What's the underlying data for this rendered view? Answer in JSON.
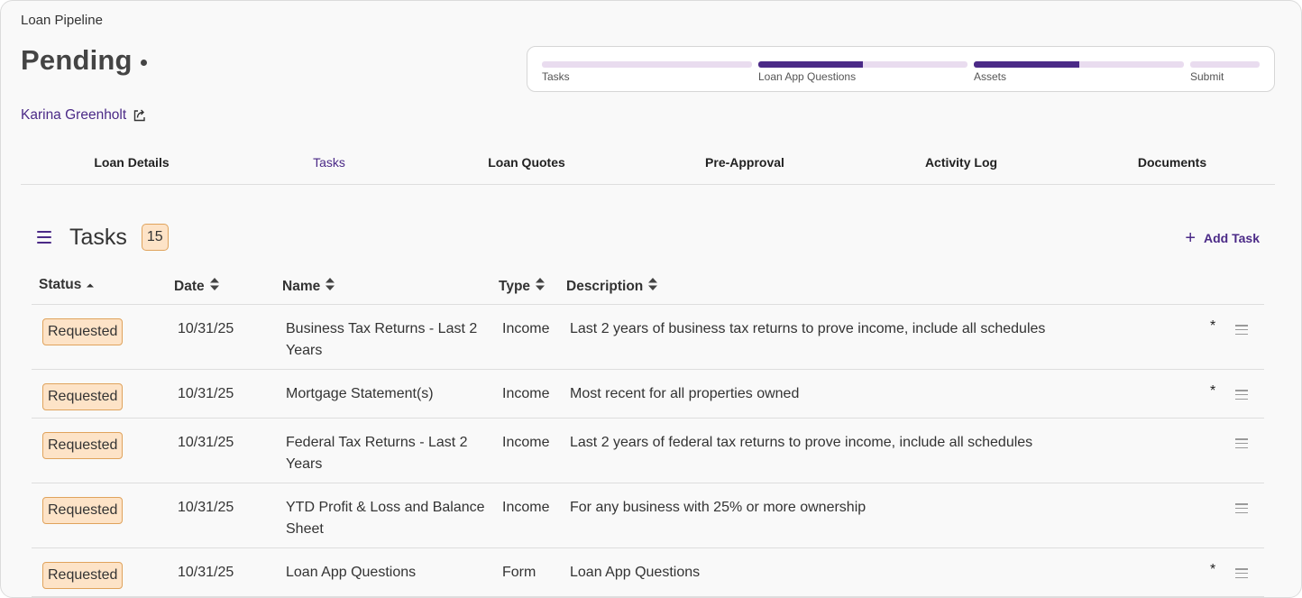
{
  "breadcrumb": "Loan Pipeline",
  "page_title": "Pending",
  "progress": {
    "steps": [
      {
        "label": "Tasks",
        "fill": 0.0
      },
      {
        "label": "Loan App Questions",
        "fill": 0.5
      },
      {
        "label": "Assets",
        "fill": 0.5
      },
      {
        "label": "Submit",
        "fill": 0.0
      }
    ],
    "accent_color": "#4b2a87",
    "track_color": "#e9dcef"
  },
  "client": {
    "name": "Karina Greenholt",
    "icon": "external-link-icon"
  },
  "tabs": [
    {
      "label": "Loan Details",
      "active": false
    },
    {
      "label": "Tasks",
      "active": true
    },
    {
      "label": "Loan Quotes",
      "active": false
    },
    {
      "label": "Pre-Approval",
      "active": false
    },
    {
      "label": "Activity Log",
      "active": false
    },
    {
      "label": "Documents",
      "active": false
    }
  ],
  "tasks_section": {
    "title": "Tasks",
    "count": "15",
    "add_label": "Add Task",
    "menu_icon": "hamburger-icon"
  },
  "table": {
    "columns": [
      {
        "label": "Status",
        "sort": "asc"
      },
      {
        "label": "Date",
        "sort": "both"
      },
      {
        "label": "Name",
        "sort": "both"
      },
      {
        "label": "Type",
        "sort": "both"
      },
      {
        "label": "Description",
        "sort": "both"
      }
    ],
    "rows": [
      {
        "status": "Requested",
        "date": "10/31/25",
        "name": "Business Tax Returns - Last 2 Years",
        "type": "Income",
        "description": "Last 2 years of business tax returns to prove income, include all schedules",
        "star": "*"
      },
      {
        "status": "Requested",
        "date": "10/31/25",
        "name": "Mortgage Statement(s)",
        "type": "Income",
        "description": "Most recent for all properties owned",
        "star": "*"
      },
      {
        "status": "Requested",
        "date": "10/31/25",
        "name": "Federal Tax Returns - Last 2 Years",
        "type": "Income",
        "description": "Last 2 years of federal tax returns to prove income, include all schedules",
        "star": ""
      },
      {
        "status": "Requested",
        "date": "10/31/25",
        "name": "YTD Profit & Loss and Balance Sheet",
        "type": "Income",
        "description": "For any business with 25% or more ownership",
        "star": ""
      },
      {
        "status": "Requested",
        "date": "10/31/25",
        "name": "Loan App Questions",
        "type": "Form",
        "description": "Loan App Questions",
        "star": "*"
      }
    ]
  },
  "colors": {
    "status_badge_bg": "#fde3c7",
    "status_badge_border": "#e0a35c"
  }
}
